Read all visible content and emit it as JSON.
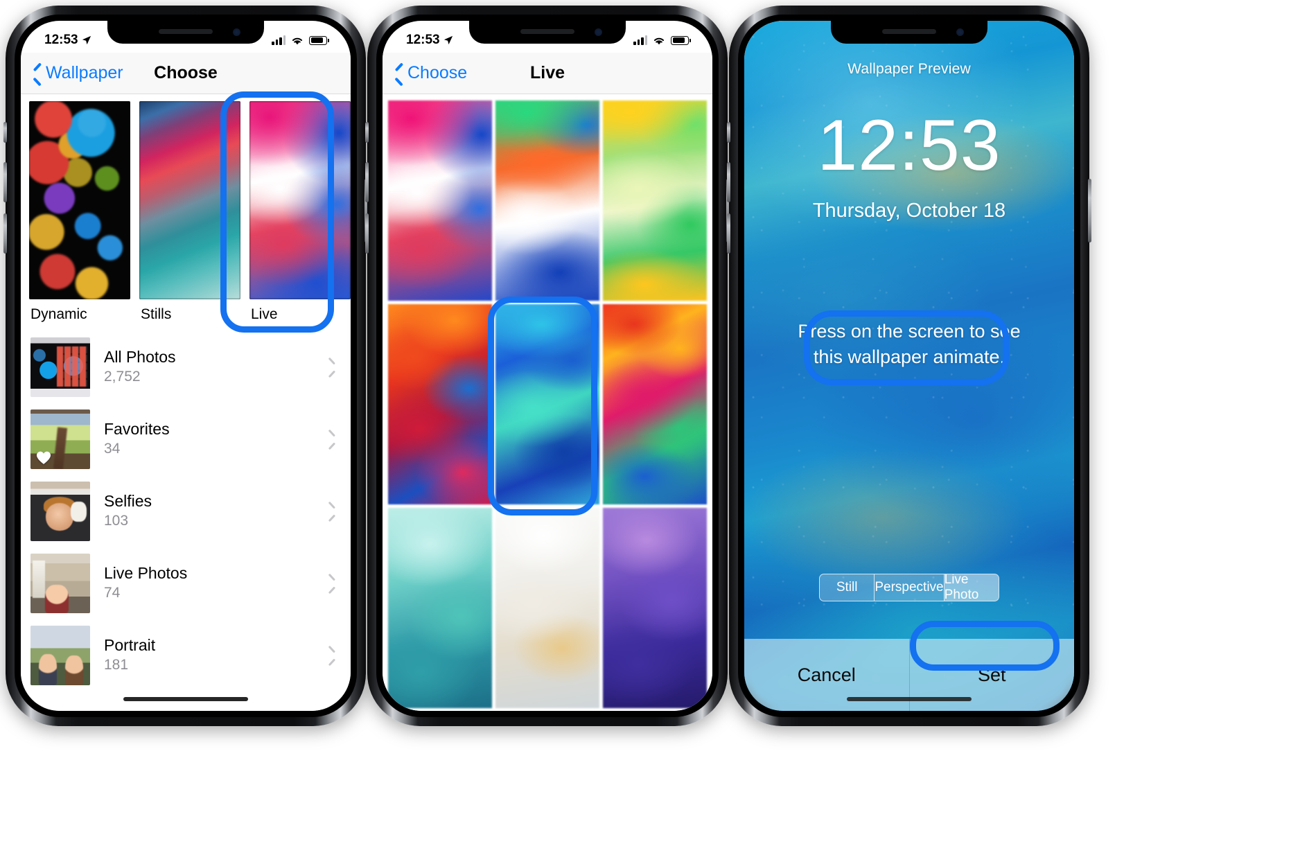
{
  "phones": [
    {
      "id": "phone-choose",
      "status": {
        "time": "12:53",
        "location_icon": "location-arrow-icon",
        "signal_icon": "cellular-bars-icon",
        "wifi_icon": "wifi-icon",
        "battery_icon": "battery-icon"
      },
      "nav": {
        "back_label": "Wallpaper",
        "title": "Choose",
        "back_icon": "chevron-left-icon"
      },
      "categories": [
        {
          "label": "Dynamic",
          "thumb": "dynamic-bokeh-thumb"
        },
        {
          "label": "Stills",
          "thumb": "stills-gradient-thumb"
        },
        {
          "label": "Live",
          "thumb": "live-gradient-thumb",
          "highlighted": true
        }
      ],
      "albums": [
        {
          "name": "All Photos",
          "count": "2,752",
          "thumb": "all-photos-thumb"
        },
        {
          "name": "Favorites",
          "count": "34",
          "thumb": "favorites-thumb"
        },
        {
          "name": "Selfies",
          "count": "103",
          "thumb": "selfies-thumb"
        },
        {
          "name": "Live Photos",
          "count": "74",
          "thumb": "live-photos-thumb"
        },
        {
          "name": "Portrait",
          "count": "181",
          "thumb": "portrait-thumb"
        }
      ]
    },
    {
      "id": "phone-live",
      "status": {
        "time": "12:53",
        "location_icon": "location-arrow-icon",
        "signal_icon": "cellular-bars-icon",
        "wifi_icon": "wifi-icon",
        "battery_icon": "battery-icon"
      },
      "nav": {
        "back_label": "Choose",
        "title": "Live",
        "back_icon": "chevron-left-icon"
      },
      "grid": [
        {
          "name": "live-wallpaper-1"
        },
        {
          "name": "live-wallpaper-2"
        },
        {
          "name": "live-wallpaper-3"
        },
        {
          "name": "live-wallpaper-4"
        },
        {
          "name": "live-wallpaper-5",
          "highlighted": true
        },
        {
          "name": "live-wallpaper-6"
        },
        {
          "name": "live-wallpaper-7"
        },
        {
          "name": "live-wallpaper-8"
        },
        {
          "name": "live-wallpaper-9"
        }
      ]
    },
    {
      "id": "phone-preview",
      "preview_label": "Wallpaper Preview",
      "clock": "12:53",
      "date": "Thursday, October 18",
      "hint_line_1": "Press on the screen to see",
      "hint_line_2": "this wallpaper animate.",
      "segments": [
        {
          "label": "Still",
          "active": false
        },
        {
          "label": "Perspective",
          "active": false
        },
        {
          "label": "Live Photo",
          "active": true
        }
      ],
      "actions": {
        "cancel_label": "Cancel",
        "set_label": "Set"
      }
    }
  ],
  "annotation": {
    "color": "#1471f0",
    "targets": [
      "live-category-highlight",
      "live-wallpaper-5-highlight",
      "press-hint-highlight",
      "set-button-highlight"
    ]
  }
}
